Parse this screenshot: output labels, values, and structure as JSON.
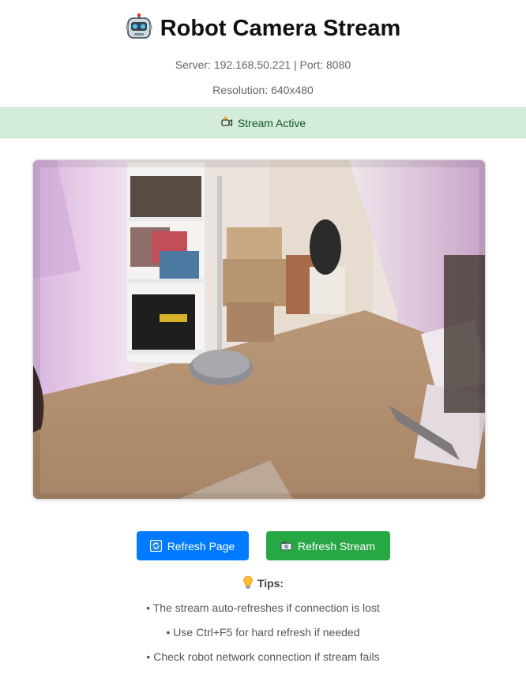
{
  "header": {
    "title": "Robot Camera Stream",
    "title_icon": "robot-icon",
    "server_info": "Server: 192.168.50.221 | Port: 8080",
    "resolution": "Resolution: 640x480"
  },
  "status": {
    "icon": "camera-icon",
    "text": "Stream Active",
    "background": "#d4edda",
    "color": "#155724"
  },
  "stream": {
    "description_icon": "camera-feed-image"
  },
  "buttons": {
    "refresh_page": {
      "label": "Refresh Page",
      "icon": "refresh-icon",
      "color": "#007bff"
    },
    "refresh_stream": {
      "label": "Refresh Stream",
      "icon": "camera-icon",
      "color": "#28a745"
    }
  },
  "tips": {
    "title": "Tips:",
    "icon": "lightbulb-icon",
    "items": [
      "• The stream auto-refreshes if connection is lost",
      "• Use Ctrl+F5 for hard refresh if needed",
      "• Check robot network connection if stream fails"
    ]
  }
}
